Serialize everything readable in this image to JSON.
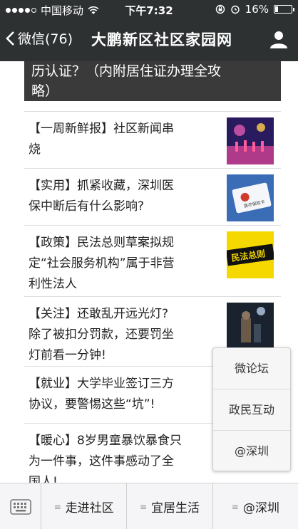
{
  "status_bar": {
    "carrier": "中国移动",
    "time": "下午7:32",
    "battery_percent": "16%",
    "battery_level": 0.16,
    "icons": [
      "signal-dots",
      "wifi-icon",
      "rotation-lock-icon",
      "alarm-icon",
      "battery-icon"
    ]
  },
  "nav": {
    "back_label": "微信(76)",
    "title": "大鹏新区社区家园网",
    "user_icon": "user-icon"
  },
  "hero": {
    "text_line1": "历认证？（内附居住证办理全攻",
    "text_line2": "略）"
  },
  "articles": [
    {
      "line1": "【一周新鲜报】社区新闻串",
      "line2": "烧",
      "line3": ""
    },
    {
      "line1": "【实用】抓紧收藏，深圳医",
      "line2": "保中断后有什么影响?",
      "line3": ""
    },
    {
      "line1": "【政策】民法总则草案拟规",
      "line2": "定“社会服务机构”属于非营",
      "line3": "利性法人"
    },
    {
      "line1": "【关注】还敢乱开远光灯?",
      "line2": "除了被扣分罚款，还要罚坐",
      "line3": "灯前看一分钟!"
    },
    {
      "line1": "【就业】大学毕业签订三方",
      "line2": "协议，要警惕这些“坑”!",
      "line3": ""
    },
    {
      "line1": "【暖心】8岁男童暴饮暴食只",
      "line2": "为一件事，这件事感动了全",
      "line3": "国人!"
    }
  ],
  "thumb_text": {
    "card": "医疗保险卡",
    "law": "民法总则"
  },
  "popup_menu": [
    "微论坛",
    "政民互动",
    "@深圳"
  ],
  "bottom_menu": {
    "keyboard_icon": "keyboard-icon",
    "items": [
      "走进社区",
      "宜居生活",
      "@深圳"
    ]
  },
  "colors": {
    "nav_bg": "#2e3132",
    "popup_bg": "#f6f6f6",
    "bottom_bg": "#f5f5f7"
  }
}
